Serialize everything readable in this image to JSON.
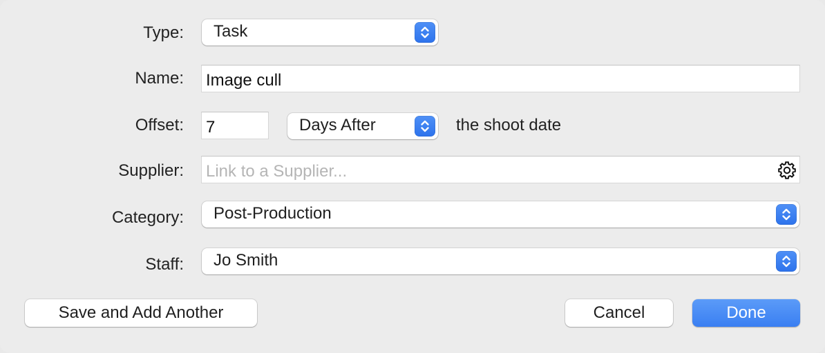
{
  "form": {
    "type": {
      "label": "Type:",
      "value": "Task"
    },
    "name": {
      "label": "Name:",
      "value": "Image cull"
    },
    "offset": {
      "label": "Offset:",
      "value": "7",
      "direction": "Days After",
      "suffix": "the shoot date"
    },
    "supplier": {
      "label": "Supplier:",
      "placeholder": "Link to a Supplier..."
    },
    "category": {
      "label": "Category:",
      "value": "Post-Production"
    },
    "staff": {
      "label": "Staff:",
      "value": "Jo Smith"
    }
  },
  "buttons": {
    "save_and_add_another": "Save and Add Another",
    "cancel": "Cancel",
    "done": "Done"
  },
  "colors": {
    "accent": "#3a7ff2",
    "window_background": "#ececec",
    "placeholder_text": "#b5b5b5"
  },
  "icons": {
    "popup_indicator": "chevron-up-down-icon",
    "supplier_action": "gear-icon"
  }
}
